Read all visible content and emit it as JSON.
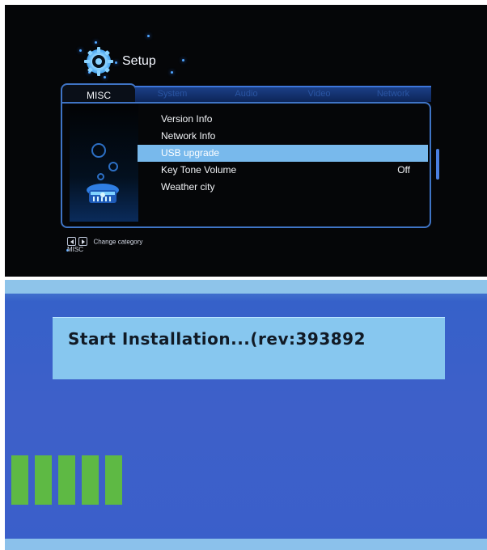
{
  "setup": {
    "title": "Setup",
    "active_tab": "MISC",
    "tabs": [
      "System",
      "Audio",
      "Video",
      "Network"
    ],
    "menu": [
      {
        "label": "Version Info",
        "value": ""
      },
      {
        "label": "Network Info",
        "value": ""
      },
      {
        "label": "USB upgrade",
        "value": ""
      },
      {
        "label": "Key Tone Volume",
        "value": "Off"
      },
      {
        "label": "Weather city",
        "value": ""
      }
    ],
    "selected_item": "USB upgrade",
    "footer_hint": "Change category",
    "footer_category": "MISC"
  },
  "upgrade": {
    "message": "Start Installation...(rev:393892",
    "progress_segments_filled": 5
  },
  "colors": {
    "setup_background": "#050608",
    "menu_highlight": "#78b9ec",
    "frame_blue": "#3f74c5",
    "upgrade_background": "#3a5fca",
    "message_box": "#87c7ef",
    "progress_green": "#5eb944"
  },
  "icons": [
    "gear-icon",
    "treasure-chest-icon",
    "left-arrow-icon",
    "right-arrow-icon"
  ]
}
